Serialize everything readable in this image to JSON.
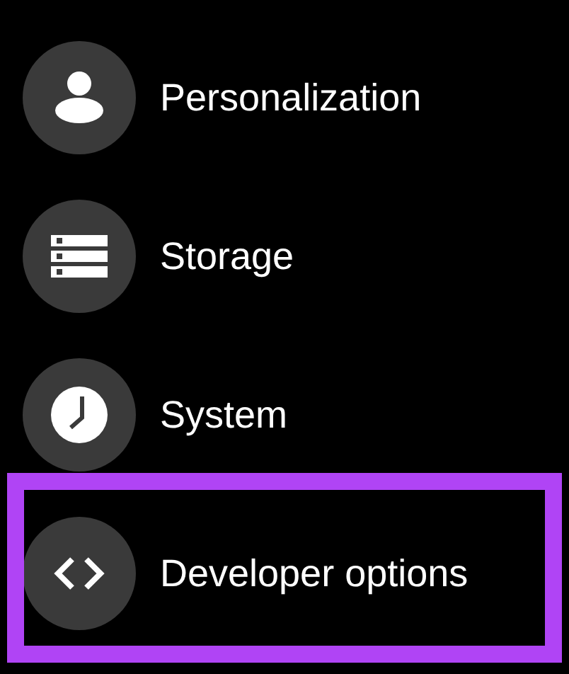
{
  "items": [
    {
      "label": "Personalization",
      "kind": "person",
      "highlighted": false
    },
    {
      "label": "Storage",
      "kind": "storage",
      "highlighted": false
    },
    {
      "label": "System",
      "kind": "clock",
      "highlighted": false
    },
    {
      "label": "Developer options",
      "kind": "code",
      "highlighted": true
    }
  ]
}
